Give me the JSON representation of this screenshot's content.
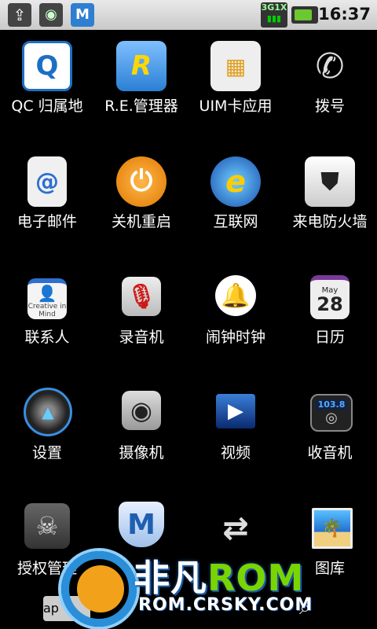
{
  "status_bar": {
    "time": "16:37",
    "network": "3G1X",
    "icons": [
      "usb-icon",
      "android-debug-icon",
      "m-app-icon"
    ]
  },
  "apps": [
    {
      "label": "QC 归属地",
      "icon": "qc-location-icon"
    },
    {
      "label": "R.E.管理器",
      "icon": "file-cabinet-icon"
    },
    {
      "label": "UIM卡应用",
      "icon": "sim-card-icon"
    },
    {
      "label": "拨号",
      "icon": "phone-handset-icon"
    },
    {
      "label": "电子邮件",
      "icon": "email-icon"
    },
    {
      "label": "关机重启",
      "icon": "power-icon"
    },
    {
      "label": "互联网",
      "icon": "browser-globe-icon"
    },
    {
      "label": "来电防火墙",
      "icon": "shield-phone-icon"
    },
    {
      "label": "联系人",
      "icon": "contacts-icon"
    },
    {
      "label": "录音机",
      "icon": "microphone-icon"
    },
    {
      "label": "闹钟时钟",
      "icon": "alarm-bell-icon"
    },
    {
      "label": "日历",
      "icon": "calendar-icon"
    },
    {
      "label": "设置",
      "icon": "settings-dial-icon"
    },
    {
      "label": "摄像机",
      "icon": "camera-lens-icon"
    },
    {
      "label": "视频",
      "icon": "video-play-icon"
    },
    {
      "label": "收音机",
      "icon": "radio-icon"
    },
    {
      "label": "授权管理",
      "icon": "android-skull-icon"
    },
    {
      "label": "",
      "icon": "m-shield-usb-icon"
    },
    {
      "label": "",
      "icon": "phone-transfer-icon"
    },
    {
      "label": "图库",
      "icon": "gallery-icon"
    }
  ],
  "calendar_icon": {
    "month": "May",
    "day": "28"
  },
  "radio_icon": {
    "freq": "103.8"
  },
  "contacts_icon": {
    "text": "Creative in Mind"
  },
  "dock": {
    "button_label": "ap"
  },
  "watermark": {
    "brand_cn": "非凡",
    "brand_en": "ROM",
    "url": "ROM.CRSKY.COM"
  }
}
